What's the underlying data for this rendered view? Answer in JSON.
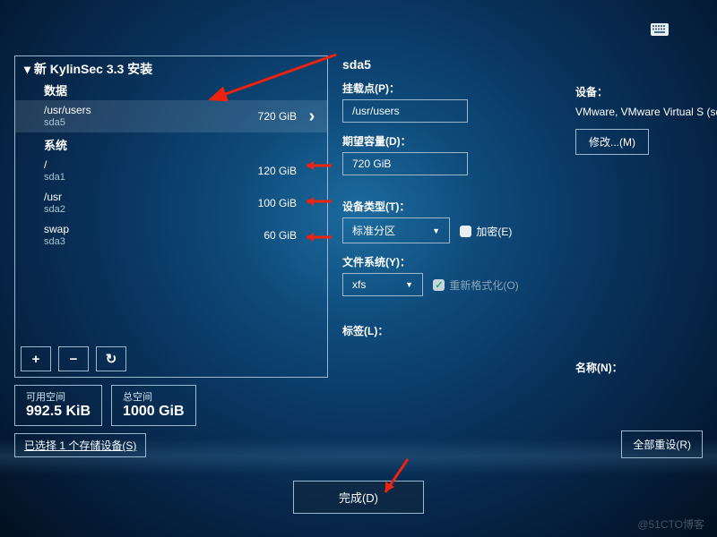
{
  "header": {
    "keyboard_icon": "keyboard-icon"
  },
  "left_panel": {
    "title_prefix": "▾ 新 KylinSec 3.3 安装",
    "sections": {
      "data": {
        "label": "数据",
        "items": [
          {
            "mount": "/usr/users",
            "dev": "sda5",
            "size": "720 GiB",
            "selected": true
          }
        ]
      },
      "system": {
        "label": "系统",
        "items": [
          {
            "mount": "/",
            "dev": "sda1",
            "size": "120 GiB"
          },
          {
            "mount": "/usr",
            "dev": "sda2",
            "size": "100 GiB"
          },
          {
            "mount": "swap",
            "dev": "sda3",
            "size": "60 GiB"
          }
        ]
      }
    },
    "buttons": {
      "add": "+",
      "remove": "−",
      "reload": "↻"
    },
    "stats": {
      "avail": {
        "label": "可用空间",
        "value": "992.5 KiB"
      },
      "total": {
        "label": "总空间",
        "value": "1000 GiB"
      }
    },
    "selected_storage": "已选择 1 个存储设备(S)"
  },
  "right_panel": {
    "title": "sda5",
    "mount_point": {
      "label": "挂载点(P)：",
      "value": "/usr/users"
    },
    "capacity": {
      "label": "期望容量(D)：",
      "value": "720 GiB"
    },
    "dev_type": {
      "label": "设备类型(T)：",
      "value": "标准分区"
    },
    "encrypt": {
      "label": "加密(E)"
    },
    "fs": {
      "label": "文件系统(Y)：",
      "value": "xfs"
    },
    "reformat": {
      "label": "重新格式化(O)"
    },
    "tag": {
      "label": "标签(L)："
    },
    "name": {
      "label": "名称(N)："
    },
    "device_col": {
      "label": "设备：",
      "value": "VMware, VMware Virtual S (sda)",
      "modify": "修改...(M)"
    }
  },
  "footer": {
    "done": "完成(D)",
    "reset_all": "全部重设(R)"
  },
  "watermark": "@51CTO博客"
}
